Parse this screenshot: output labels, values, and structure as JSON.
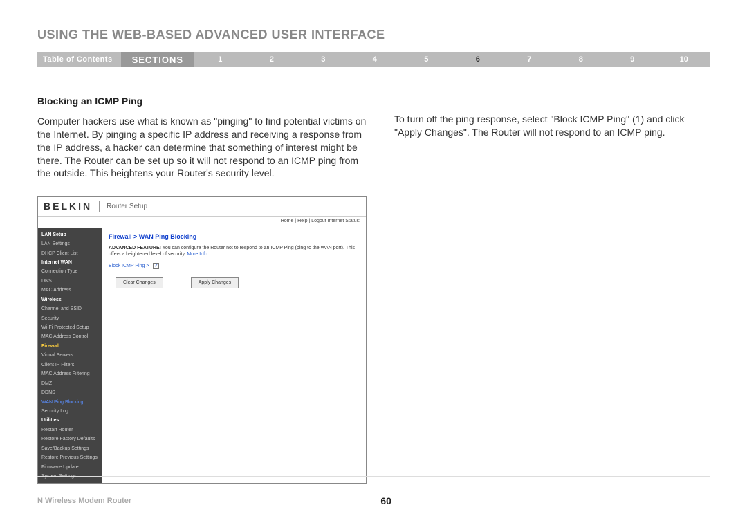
{
  "page_title": "USING THE WEB-BASED ADVANCED USER INTERFACE",
  "nav": {
    "toc": "Table of Contents",
    "sections_label": "SECTIONS",
    "numbers": [
      "1",
      "2",
      "3",
      "4",
      "5",
      "6",
      "7",
      "8",
      "9",
      "10"
    ],
    "active": "6"
  },
  "left_col": {
    "heading": "Blocking an ICMP Ping",
    "body": "Computer hackers use what is known as \"pinging\" to find potential victims on the Internet. By pinging a specific IP address and receiving a response from the IP address, a hacker can determine that something of interest might be there. The Router can be set up so it will not respond to an ICMP ping from the outside. This heightens your Router's security level."
  },
  "right_col": {
    "body": "To turn off the ping response, select \"Block ICMP Ping\" (1) and click \"Apply Changes\". The Router will not respond to an ICMP ping."
  },
  "screenshot": {
    "logo": "BELKIN",
    "subtitle": "Router Setup",
    "top_links": "Home | Help | Logout  Internet Status:",
    "sidebar": [
      {
        "label": "LAN Setup",
        "cls": "sidebar-header"
      },
      {
        "label": "LAN Settings",
        "cls": ""
      },
      {
        "label": "DHCP Client List",
        "cls": ""
      },
      {
        "label": "Internet WAN",
        "cls": "sidebar-header"
      },
      {
        "label": "Connection Type",
        "cls": ""
      },
      {
        "label": "DNS",
        "cls": ""
      },
      {
        "label": "MAC Address",
        "cls": ""
      },
      {
        "label": "Wireless",
        "cls": "sidebar-header"
      },
      {
        "label": "Channel and SSID",
        "cls": ""
      },
      {
        "label": "Security",
        "cls": ""
      },
      {
        "label": "Wi-Fi Protected Setup",
        "cls": ""
      },
      {
        "label": "MAC Address Control",
        "cls": ""
      },
      {
        "label": "Firewall",
        "cls": "sidebar-active-y"
      },
      {
        "label": "Virtual Servers",
        "cls": ""
      },
      {
        "label": "Client IP Filters",
        "cls": ""
      },
      {
        "label": "MAC Address Filtering",
        "cls": ""
      },
      {
        "label": "DMZ",
        "cls": ""
      },
      {
        "label": "DDNS",
        "cls": ""
      },
      {
        "label": "WAN Ping Blocking",
        "cls": "sidebar-active-b"
      },
      {
        "label": "Security Log",
        "cls": ""
      },
      {
        "label": "Utilities",
        "cls": "sidebar-header"
      },
      {
        "label": "Restart Router",
        "cls": ""
      },
      {
        "label": "Restore Factory Defaults",
        "cls": ""
      },
      {
        "label": "Save/Backup Settings",
        "cls": ""
      },
      {
        "label": "Restore Previous Settings",
        "cls": ""
      },
      {
        "label": "Firmware Update",
        "cls": ""
      },
      {
        "label": "System Settings",
        "cls": ""
      }
    ],
    "panel": {
      "title": "Firewall > WAN Ping Blocking",
      "desc_bold": "ADVANCED FEATURE!",
      "desc_rest": " You can configure the Router not to respond to an ICMP Ping (ping to the WAN port). This offers a heightened level of security. ",
      "more_info": "More Info",
      "block_label": "Block ICMP Ping >",
      "checked": "✓",
      "btn_clear": "Clear Changes",
      "btn_apply": "Apply Changes"
    }
  },
  "footer": {
    "left": "N Wireless Modem Router",
    "page": "60"
  }
}
